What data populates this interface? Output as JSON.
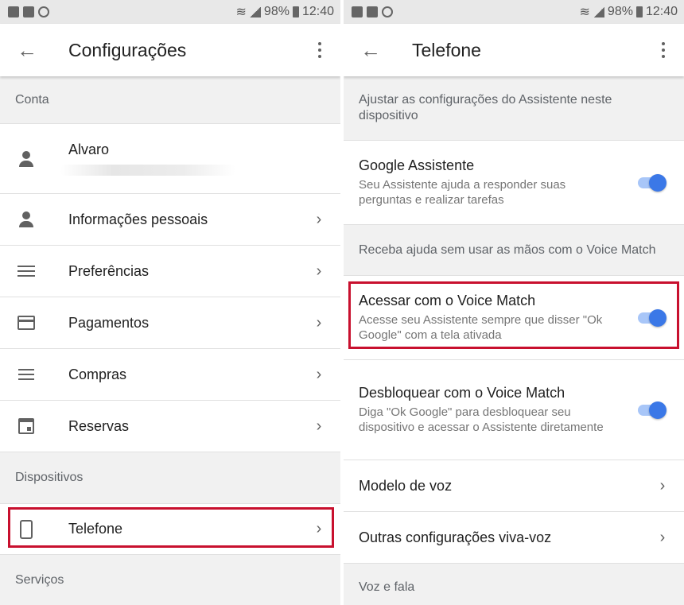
{
  "status_bar": {
    "battery": "98%",
    "time": "12:40"
  },
  "left": {
    "title": "Configurações",
    "sections": {
      "conta": "Conta",
      "dispositivos": "Dispositivos",
      "servicos": "Serviços"
    },
    "account": {
      "name": "Alvaro"
    },
    "items": [
      {
        "label": "Informações pessoais",
        "icon": "person-icon"
      },
      {
        "label": "Preferências",
        "icon": "tune-icon"
      },
      {
        "label": "Pagamentos",
        "icon": "credit-card-icon"
      },
      {
        "label": "Compras",
        "icon": "list-icon"
      },
      {
        "label": "Reservas",
        "icon": "calendar-icon"
      }
    ],
    "device": {
      "label": "Telefone",
      "icon": "phone-icon"
    }
  },
  "right": {
    "title": "Telefone",
    "intro": "Ajustar as configurações do Assistente neste dispositivo",
    "assistant": {
      "title": "Google Assistente",
      "subtitle": "Seu Assistente ajuda a responder suas perguntas e realizar tarefas",
      "enabled": true
    },
    "voice_match_header": "Receba ajuda sem usar as mãos com o Voice Match",
    "voice_access": {
      "title": "Acessar com o Voice Match",
      "subtitle": "Acesse seu Assistente sempre que disser \"Ok Google\" com a tela ativada",
      "enabled": true
    },
    "voice_unlock": {
      "title": "Desbloquear com o Voice Match",
      "subtitle": "Diga \"Ok Google\" para desbloquear seu dispositivo e acessar o Assistente diretamente",
      "enabled": true
    },
    "voice_model": "Modelo de voz",
    "handsfree": "Outras configurações viva-voz",
    "voice_speech_header": "Voz e fala"
  },
  "colors": {
    "accent": "#3b78e7",
    "highlight": "#c8102e",
    "section_bg": "#f1f1f1"
  }
}
